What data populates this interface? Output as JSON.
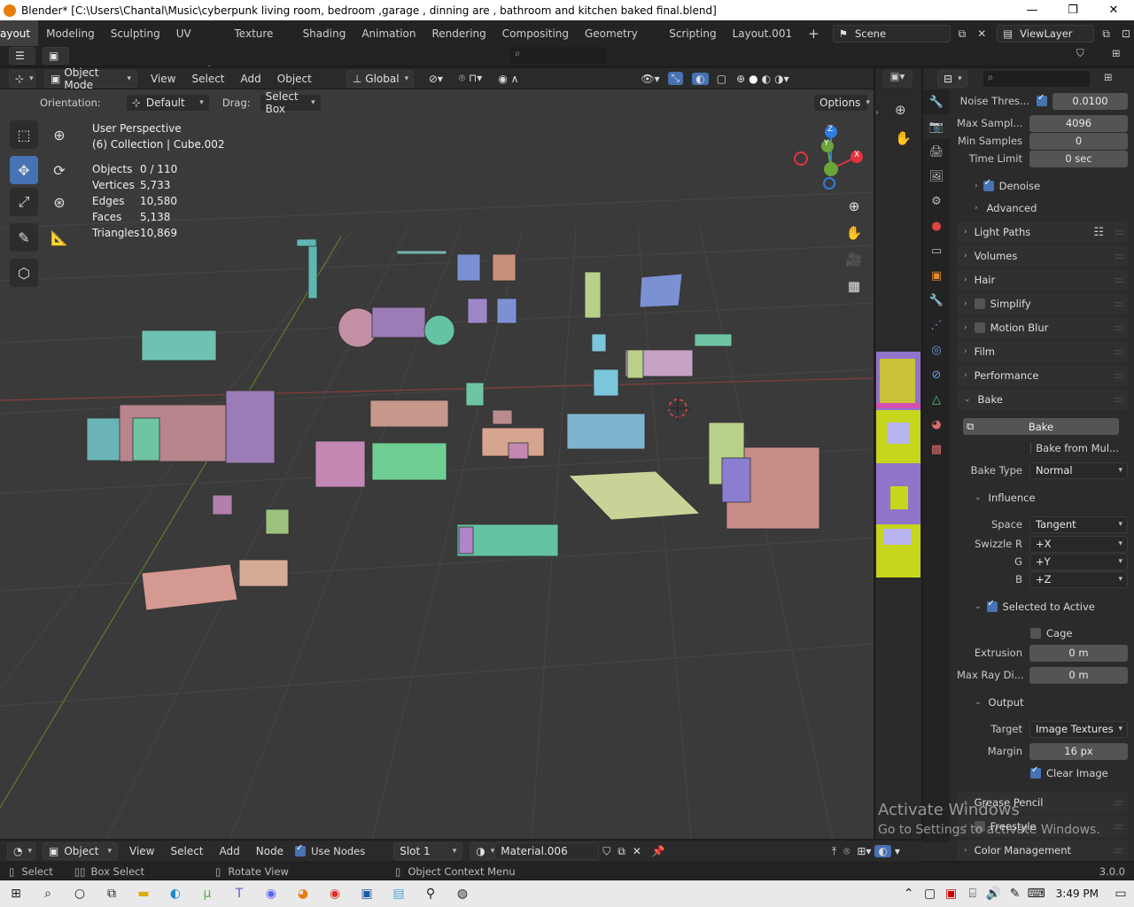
{
  "titlebar": {
    "title": "Blender* [C:\\Users\\Chantal\\Music\\cyberpunk living room, bedroom ,garage , dinning are , bathroom and kitchen baked  final.blend]",
    "min": "—",
    "restore": "❐",
    "close": "✕"
  },
  "workspaces": {
    "tabs": [
      "ayout",
      "Modeling",
      "Sculpting",
      "UV Editing",
      "Texture Paint",
      "Shading",
      "Animation",
      "Rendering",
      "Compositing",
      "Geometry Nodes",
      "Scripting",
      "Layout.001"
    ],
    "add": "+",
    "scene": "Scene",
    "view_layer": "ViewLayer"
  },
  "viewport_header": {
    "mode": "Object Mode",
    "menus": [
      "View",
      "Select",
      "Add",
      "Object"
    ],
    "transform_orientation": "Global"
  },
  "viewport_sub": {
    "orientation_label": "Orientation:",
    "orientation_value": "Default",
    "drag_label": "Drag:",
    "drag_value": "Select Box",
    "options": "Options"
  },
  "overlay": {
    "perspective": "User Perspective",
    "collection": "(6) Collection | Cube.002",
    "stats": [
      {
        "k": "Objects",
        "v": "0 / 110"
      },
      {
        "k": "Vertices",
        "v": "5,733"
      },
      {
        "k": "Edges",
        "v": "10,580"
      },
      {
        "k": "Faces",
        "v": "5,138"
      },
      {
        "k": "Triangles",
        "v": "10,869"
      }
    ]
  },
  "gizmo": {
    "z": "Z",
    "y": "Y",
    "x": "X"
  },
  "properties": {
    "noise_threshold": {
      "label": "Noise Thres...",
      "value": "0.0100"
    },
    "max_samples": {
      "label": "Max Sampl...",
      "value": "4096"
    },
    "min_samples": {
      "label": "Min Samples",
      "value": "0"
    },
    "time_limit": {
      "label": "Time Limit",
      "value": "0 sec"
    },
    "denoise": "Denoise",
    "advanced": "Advanced",
    "panels": [
      "Light Paths",
      "Volumes",
      "Hair",
      "Simplify",
      "Motion Blur",
      "Film",
      "Performance"
    ],
    "bake_panel": "Bake",
    "bake_button": "Bake",
    "bake_from_multires": "Bake from Mul...",
    "bake_type": {
      "label": "Bake Type",
      "value": "Normal"
    },
    "influence": "Influence",
    "space": {
      "label": "Space",
      "value": "Tangent"
    },
    "swizzle_r": {
      "label": "Swizzle R",
      "value": "+X"
    },
    "swizzle_g": {
      "label": "G",
      "value": "+Y"
    },
    "swizzle_b": {
      "label": "B",
      "value": "+Z"
    },
    "selected_to_active": "Selected to Active",
    "cage": "Cage",
    "extrusion": {
      "label": "Extrusion",
      "value": "0 m"
    },
    "max_ray": {
      "label": "Max Ray Di...",
      "value": "0 m"
    },
    "output": "Output",
    "target": {
      "label": "Target",
      "value": "Image Textures"
    },
    "margin": {
      "label": "Margin",
      "value": "16 px"
    },
    "clear_image": "Clear Image",
    "grease_pencil": "Grease Pencil",
    "freestyle": "Freestyle",
    "color_management": "Color Management"
  },
  "watermark": {
    "line1": "Activate Windows",
    "line2": "Go to Settings to activate Windows."
  },
  "node_header": {
    "mode": "Object",
    "menus": [
      "View",
      "Select",
      "Add",
      "Node"
    ],
    "use_nodes": "Use Nodes",
    "slot": "Slot 1",
    "material": "Material.006"
  },
  "statusbar": {
    "select": "Select",
    "box_select": "Box Select",
    "rotate_view": "Rotate View",
    "context_menu": "Object Context Menu",
    "version": "3.0.0"
  },
  "taskbar": {
    "time": "3:49 PM"
  },
  "colors": {
    "accent": "#4772b3",
    "gizmo_x": "#e5323f",
    "gizmo_y": "#6ba539",
    "gizmo_z": "#2f7de0"
  }
}
